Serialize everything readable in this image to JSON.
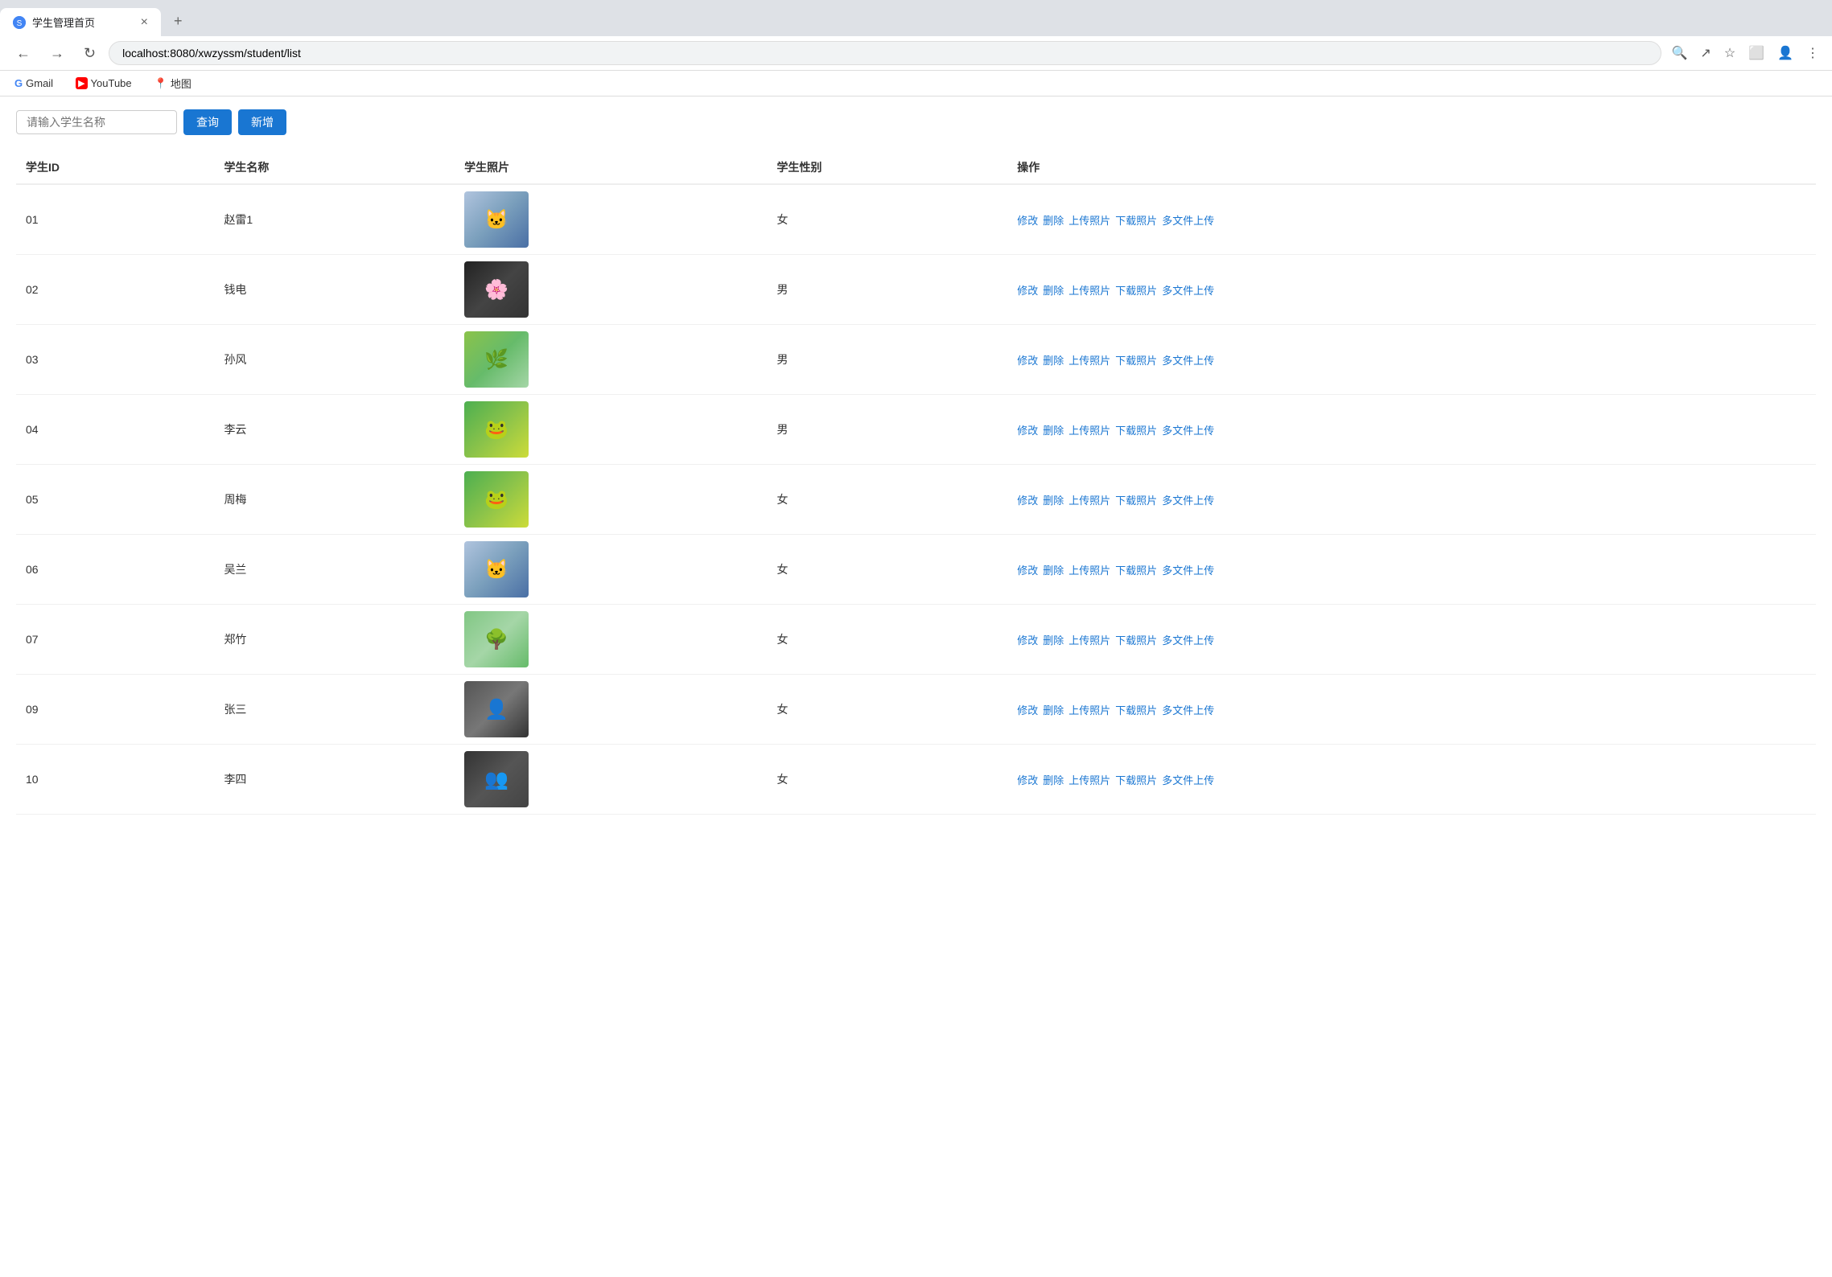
{
  "browser": {
    "tab_title": "学生管理首页",
    "tab_close": "×",
    "tab_new": "+",
    "url": "localhost:8080/xwzyssm/student/list",
    "nav": {
      "back": "←",
      "forward": "→",
      "reload": "↻"
    },
    "bookmarks": [
      {
        "id": "gmail",
        "icon_type": "g",
        "label": "Gmail"
      },
      {
        "id": "youtube",
        "icon_type": "yt",
        "label": "YouTube"
      },
      {
        "id": "maps",
        "icon_type": "map",
        "label": "地图"
      }
    ]
  },
  "page": {
    "search": {
      "placeholder": "请输入学生名称",
      "query_label": "查询",
      "add_label": "新增"
    },
    "table": {
      "headers": [
        "学生ID",
        "学生名称",
        "学生照片",
        "学生性别",
        "操作"
      ],
      "actions": [
        "修改",
        "删除",
        "上传照片",
        "下载照片",
        "多文件上传"
      ]
    },
    "students": [
      {
        "id": "01",
        "name": "赵雷1",
        "gender": "女",
        "photo_class": "photo-1",
        "photo_icon": "🐱"
      },
      {
        "id": "02",
        "name": "钱电",
        "gender": "男",
        "photo_class": "photo-2",
        "photo_icon": "🌸"
      },
      {
        "id": "03",
        "name": "孙风",
        "gender": "男",
        "photo_class": "photo-3",
        "photo_icon": "🌿"
      },
      {
        "id": "04",
        "name": "李云",
        "gender": "男",
        "photo_class": "photo-4",
        "photo_icon": "🐸"
      },
      {
        "id": "05",
        "name": "周梅",
        "gender": "女",
        "photo_class": "photo-5",
        "photo_icon": "🐸"
      },
      {
        "id": "06",
        "name": "吴兰",
        "gender": "女",
        "photo_class": "photo-6",
        "photo_icon": "🐱"
      },
      {
        "id": "07",
        "name": "郑竹",
        "gender": "女",
        "photo_class": "photo-7",
        "photo_icon": "🌳"
      },
      {
        "id": "09",
        "name": "张三",
        "gender": "女",
        "photo_class": "photo-9",
        "photo_icon": "👤"
      },
      {
        "id": "10",
        "name": "李四",
        "gender": "女",
        "photo_class": "photo-10",
        "photo_icon": "👥"
      }
    ]
  }
}
